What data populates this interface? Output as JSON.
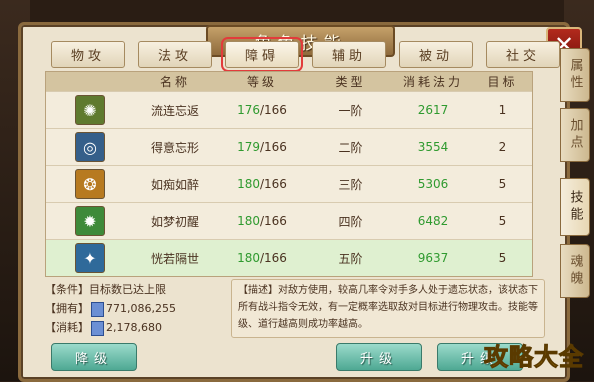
{
  "window": {
    "title": "角色技能",
    "close_label": "✕"
  },
  "tabs": [
    {
      "label": "物攻"
    },
    {
      "label": "法攻"
    },
    {
      "label": "障碍",
      "active": true
    },
    {
      "label": "辅助"
    },
    {
      "label": "被动"
    },
    {
      "label": "社交"
    }
  ],
  "table": {
    "headers": {
      "name": "名称",
      "level": "等级",
      "type": "类型",
      "cost": "消耗法力",
      "target": "目标"
    },
    "rows": [
      {
        "icon": "spiral-skill-icon",
        "icon_color": "#5f7a2f",
        "name": "流连忘返",
        "level": "176",
        "max": "/166",
        "type": "一阶",
        "cost": "2617",
        "target": "1"
      },
      {
        "icon": "swirl-skill-icon",
        "icon_color": "#355f8a",
        "name": "得意忘形",
        "level": "179",
        "max": "/166",
        "type": "二阶",
        "cost": "3554",
        "target": "2"
      },
      {
        "icon": "emblem-skill-icon",
        "icon_color": "#b77a20",
        "name": "如痴如醉",
        "level": "180",
        "max": "/166",
        "type": "三阶",
        "cost": "5306",
        "target": "5"
      },
      {
        "icon": "burst-skill-icon",
        "icon_color": "#3e8a3a",
        "name": "如梦初醒",
        "level": "180",
        "max": "/166",
        "type": "四阶",
        "cost": "6482",
        "target": "5"
      },
      {
        "icon": "star-skill-icon",
        "icon_color": "#2f6a9a",
        "name": "恍若隔世",
        "level": "180",
        "max": "/166",
        "type": "五阶",
        "cost": "9637",
        "target": "5",
        "selected": true
      }
    ]
  },
  "info": {
    "condition": "【条件】目标数已达上限",
    "owned_label": "【拥有】",
    "owned_value": "771,086,255",
    "cost_label": "【消耗】",
    "cost_value": "2,178,680"
  },
  "description": "【描述】对敌方使用，较高几率令对手多人处于遗忘状态，该状态下所有战斗指令无效，有一定概率选取敌对目标进行物理攻击。技能等级、道行越高则成功率越高。",
  "buttons": {
    "downgrade": "降级",
    "upgrade": "升级",
    "upgrade_more": "升级"
  },
  "side_tabs": [
    {
      "label": "属性"
    },
    {
      "label": "加点"
    },
    {
      "label": "技能",
      "active": true
    },
    {
      "label": "魂魄"
    }
  ],
  "watermark": "攻略大全"
}
